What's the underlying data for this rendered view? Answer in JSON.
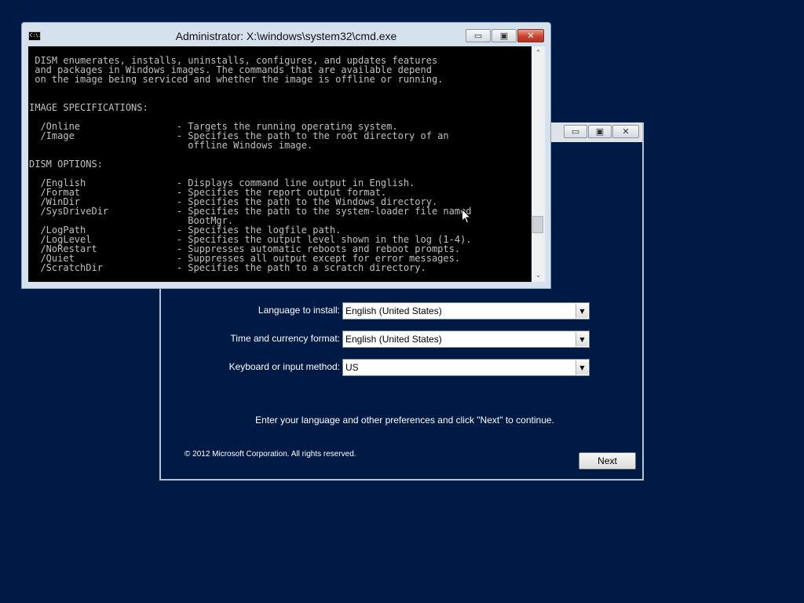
{
  "cmd": {
    "title": "Administrator: X:\\windows\\system32\\cmd.exe",
    "icon_text": "C:\\.",
    "minimize_symbol": "▭",
    "maximize_symbol": "▣",
    "close_symbol": "✕",
    "console_text": " DISM enumerates, installs, uninstalls, configures, and updates features\n and packages in Windows images. The commands that are available depend\n on the image being serviced and whether the image is offline or running.\n\n\nIMAGE SPECIFICATIONS:\n\n  /Online                 - Targets the running operating system.\n  /Image                  - Specifies the path to the root directory of an\n                            offline Windows image.\n\nDISM OPTIONS:\n\n  /English                - Displays command line output in English.\n  /Format                 - Specifies the report output format.\n  /WinDir                 - Specifies the path to the Windows directory.\n  /SysDriveDir            - Specifies the path to the system-loader file named\n                            BootMgr.\n  /LogPath                - Specifies the logfile path.\n  /LogLevel               - Specifies the output level shown in the log (1-4).\n  /NoRestart              - Suppresses automatic reboots and reboot prompts.\n  /Quiet                  - Suppresses all output except for error messages.\n  /ScratchDir             - Specifies the path to a scratch directory.",
    "scroll_up_symbol": "⌃",
    "scroll_down_symbol": "⌄"
  },
  "setup": {
    "minimize_symbol": "▭",
    "maximize_symbol": "▣",
    "close_symbol": "✕",
    "fields": [
      {
        "label": "Language to install:",
        "value": "English (United States)"
      },
      {
        "label": "Time and currency format:",
        "value": "English (United States)"
      },
      {
        "label": "Keyboard or input method:",
        "value": "US"
      }
    ],
    "dropdown_arrow": "▼",
    "instruction": "Enter your language and other preferences and click \"Next\" to continue.",
    "copyright": "© 2012 Microsoft Corporation. All rights reserved.",
    "next_label": "Next"
  },
  "colors": {
    "desktop_bg": "#001a46",
    "console_bg": "#000000",
    "console_fg": "#c0c0c0",
    "close_button": "#c8452f"
  }
}
